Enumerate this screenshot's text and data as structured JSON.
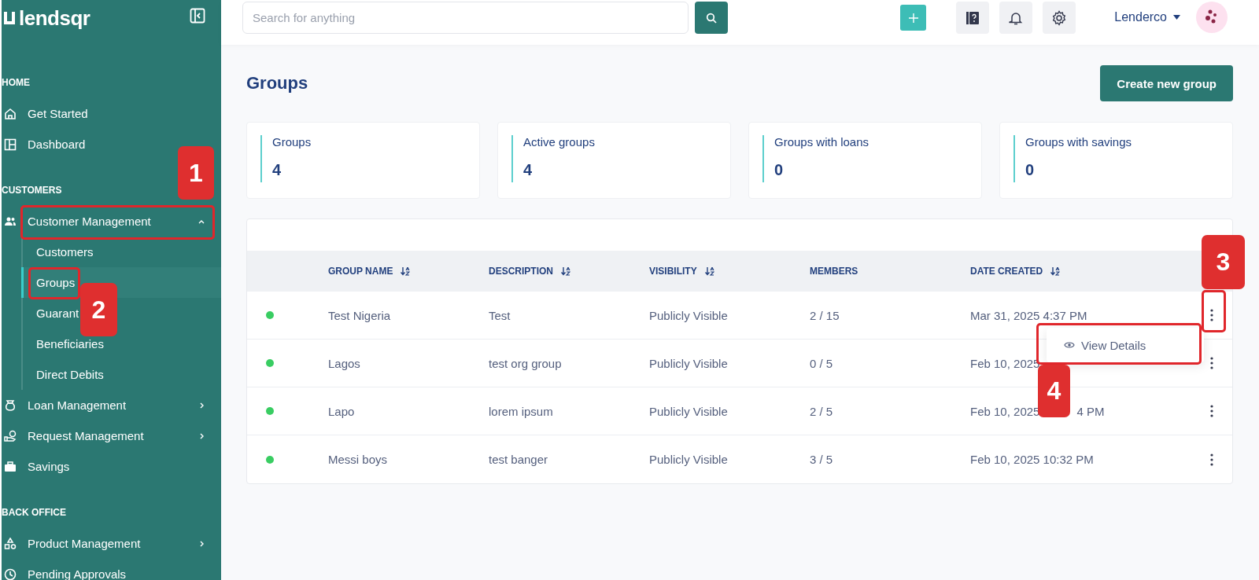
{
  "logo": "lendsqr",
  "sidebar": {
    "sections": [
      {
        "title": "HOME",
        "items": [
          {
            "label": "Get Started"
          },
          {
            "label": "Dashboard"
          }
        ]
      },
      {
        "title": "CUSTOMERS",
        "items": [
          {
            "label": "Customer Management",
            "expanded": true,
            "children": [
              {
                "label": "Customers",
                "selected": false
              },
              {
                "label": "Groups",
                "selected": true
              },
              {
                "label": "Guarant",
                "selected": false
              },
              {
                "label": "Beneficiaries",
                "selected": false
              },
              {
                "label": "Direct Debits",
                "selected": false
              }
            ]
          },
          {
            "label": "Loan Management",
            "expanded": false
          },
          {
            "label": "Request Management",
            "expanded": false
          },
          {
            "label": "Savings"
          }
        ]
      },
      {
        "title": "BACK OFFICE",
        "items": [
          {
            "label": "Product Management",
            "expanded": false
          },
          {
            "label": "Pending Approvals"
          }
        ]
      }
    ]
  },
  "topbar": {
    "search": {
      "placeholder": "Search for anything"
    },
    "user": "Lenderco"
  },
  "page": {
    "title": "Groups",
    "create_button": "Create new group"
  },
  "stats": [
    {
      "label": "Groups",
      "value": "4"
    },
    {
      "label": "Active groups",
      "value": "4"
    },
    {
      "label": "Groups with loans",
      "value": "0"
    },
    {
      "label": "Groups with savings",
      "value": "0"
    }
  ],
  "table": {
    "columns": [
      {
        "label": "GROUP NAME",
        "sortable": true
      },
      {
        "label": "DESCRIPTION",
        "sortable": true
      },
      {
        "label": "VISIBILITY",
        "sortable": true
      },
      {
        "label": "MEMBERS",
        "sortable": false
      },
      {
        "label": "DATE CREATED",
        "sortable": true
      }
    ],
    "rows": [
      {
        "active": true,
        "cells": [
          "Test Nigeria",
          "Test",
          "Publicly Visible",
          "2 / 15"
        ],
        "date": [
          "Mar 31, 2025 4:37 PM"
        ],
        "menu": [
          {
            "label": "View Details"
          }
        ]
      },
      {
        "active": true,
        "cells": [
          "Lagos",
          "test org group",
          "Publicly Visible",
          "0 / 5"
        ],
        "date": [
          "Feb 10, 2025"
        ]
      },
      {
        "active": true,
        "cells": [
          "Lapo",
          "lorem ipsum",
          "Publicly Visible",
          "2 / 5"
        ],
        "date": [
          "Feb 10, 2025",
          "4 PM"
        ]
      },
      {
        "active": true,
        "cells": [
          "Messi boys",
          "test banger",
          "Publicly Visible",
          "3 / 5"
        ],
        "date": [
          "Feb 10, 2025 10:32 PM"
        ]
      }
    ]
  },
  "annotations": [
    {
      "label": "1"
    },
    {
      "label": "2"
    },
    {
      "label": "3"
    },
    {
      "label": "4"
    }
  ]
}
